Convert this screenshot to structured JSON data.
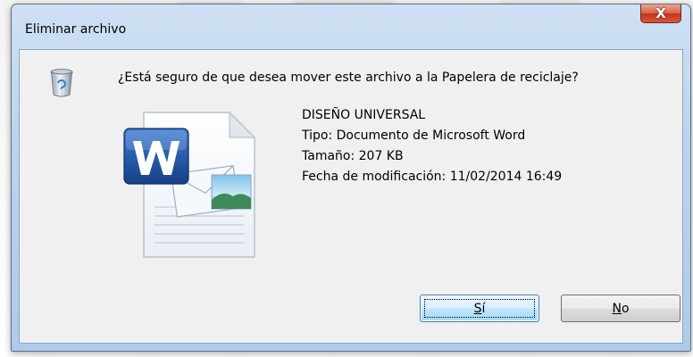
{
  "dialog": {
    "title": "Eliminar archivo",
    "close_glyph": "X",
    "question": "¿Está seguro de que desea mover este archivo a la Papelera de reciclaje?",
    "file": {
      "name": "DISEÑO UNIVERSAL",
      "type": "Tipo: Documento de Microsoft Word",
      "size": "Tamaño: 207 KB",
      "modified": "Fecha de modificación: 11/02/2014 16:49"
    },
    "buttons": {
      "yes_mnemonic": "S",
      "yes_rest": "í",
      "no_mnemonic": "N",
      "no_rest": "o"
    }
  },
  "icons": {
    "recycle": "recycle-bin-icon",
    "document": "word-document-icon",
    "close": "close-icon"
  },
  "colors": {
    "frame": "#bcd3ee",
    "client": "#f0f0f0",
    "close_red": "#c4341b",
    "default_button_border": "#3c7fb1",
    "word_blue": "#1e5aa8"
  }
}
